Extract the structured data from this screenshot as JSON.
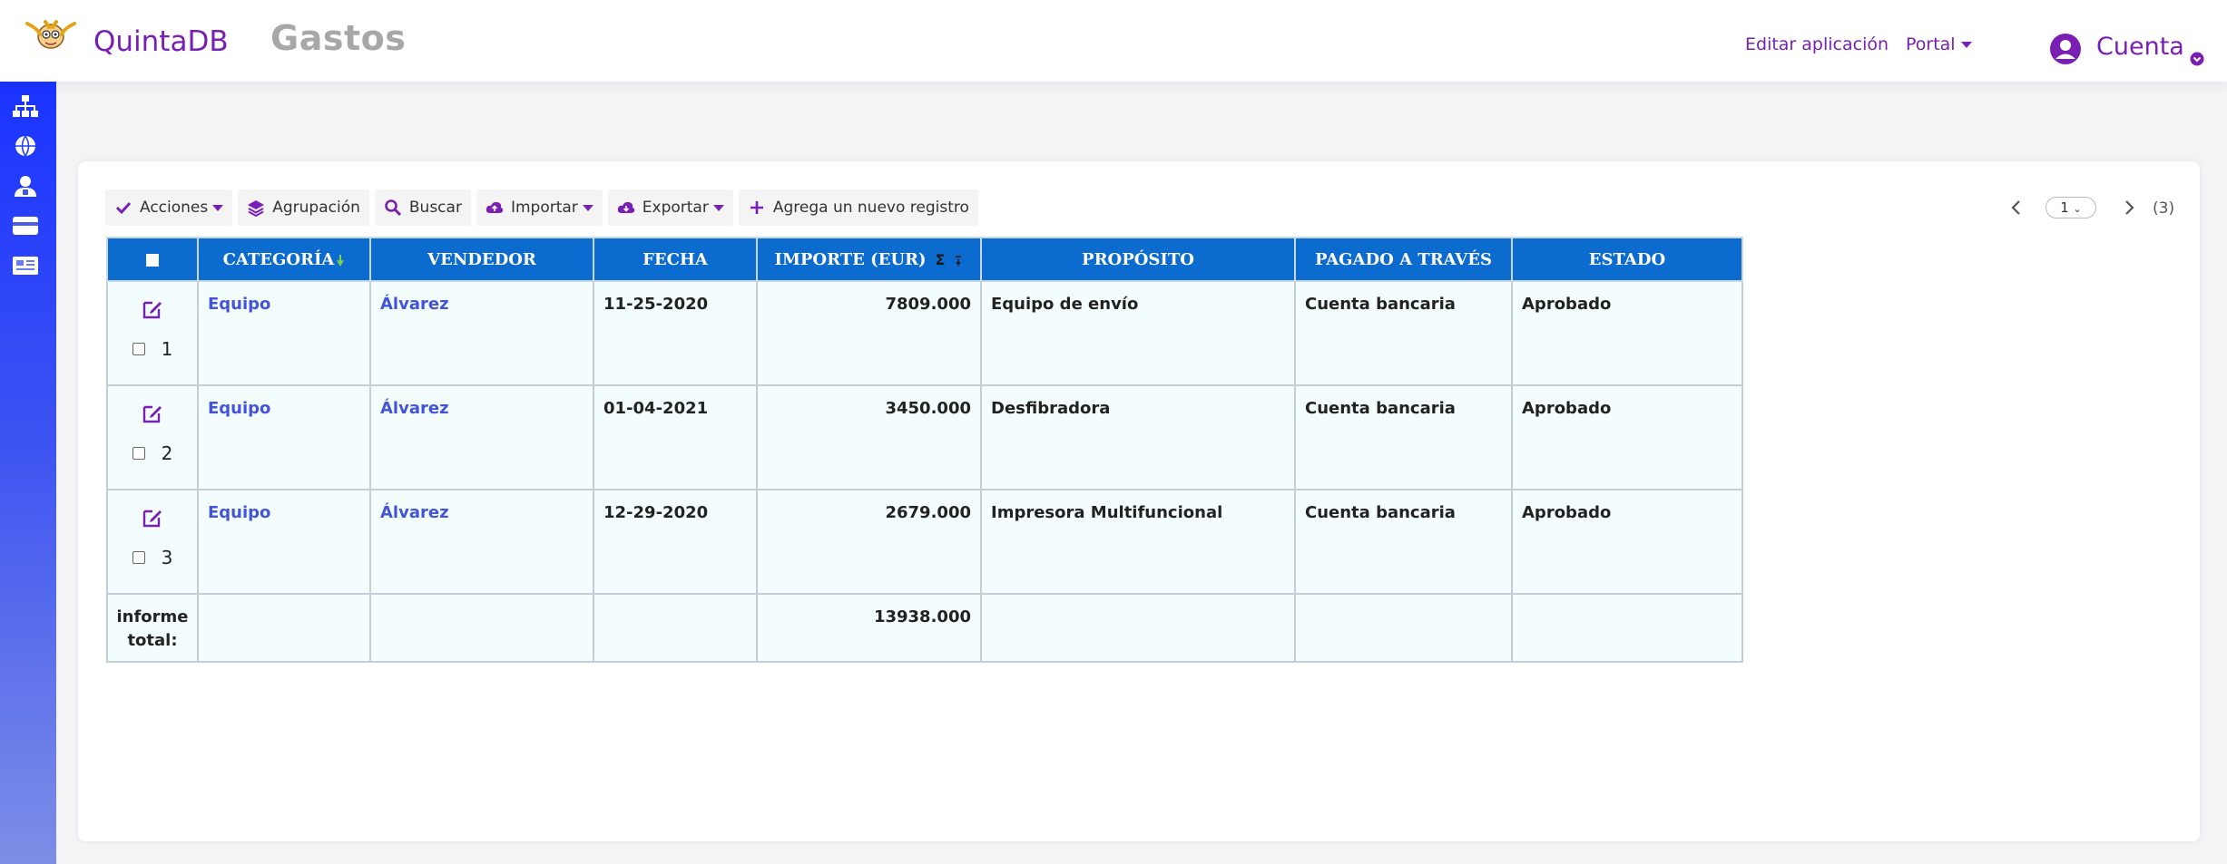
{
  "header": {
    "brand": "QuintaDB",
    "app_title": "Gastos",
    "nav": {
      "edit_app": "Editar aplicación",
      "portal": "Portal"
    },
    "account": "Cuenta"
  },
  "sidebar": {
    "items": [
      {
        "icon": "sitemap-icon"
      },
      {
        "icon": "globe-icon"
      },
      {
        "icon": "users-icon"
      },
      {
        "icon": "credit-card-icon"
      },
      {
        "icon": "newspaper-icon"
      }
    ]
  },
  "toolbar": {
    "actions": "Acciones",
    "grouping": "Agrupación",
    "search": "Buscar",
    "import": "Importar",
    "export": "Exportar",
    "add_record": "Agrega un nuevo registro"
  },
  "pager": {
    "current_page": "1",
    "total": "(3)"
  },
  "table": {
    "columns": [
      "CATEGORÍA",
      "VENDEDOR",
      "FECHA",
      "IMPORTE (EUR)",
      "PROPÓSITO",
      "PAGADO A TRAVÉS",
      "ESTADO"
    ],
    "sum_symbol": "Σ",
    "rows": [
      {
        "num": "1",
        "categoria": "Equipo",
        "vendedor": "Álvarez",
        "fecha": "11-25-2020",
        "importe": "7809.000",
        "proposito": "Equipo de envío",
        "pagado": "Cuenta bancaria",
        "estado": "Aprobado"
      },
      {
        "num": "2",
        "categoria": "Equipo",
        "vendedor": "Álvarez",
        "fecha": "01-04-2021",
        "importe": "3450.000",
        "proposito": "Desfibradora",
        "pagado": "Cuenta bancaria",
        "estado": "Aprobado"
      },
      {
        "num": "3",
        "categoria": "Equipo",
        "vendedor": "Álvarez",
        "fecha": "12-29-2020",
        "importe": "2679.000",
        "proposito": "Impresora Multifuncional",
        "pagado": "Cuenta bancaria",
        "estado": "Aprobado"
      }
    ],
    "total": {
      "label": "informe total:",
      "importe": "13938.000"
    }
  },
  "colors": {
    "brand_purple": "#7a1fb3",
    "header_blue": "#0b6bcf",
    "link_blue": "#4354d9",
    "row_bg": "#f3fdfd",
    "sidebar_top": "#1a33ff"
  }
}
